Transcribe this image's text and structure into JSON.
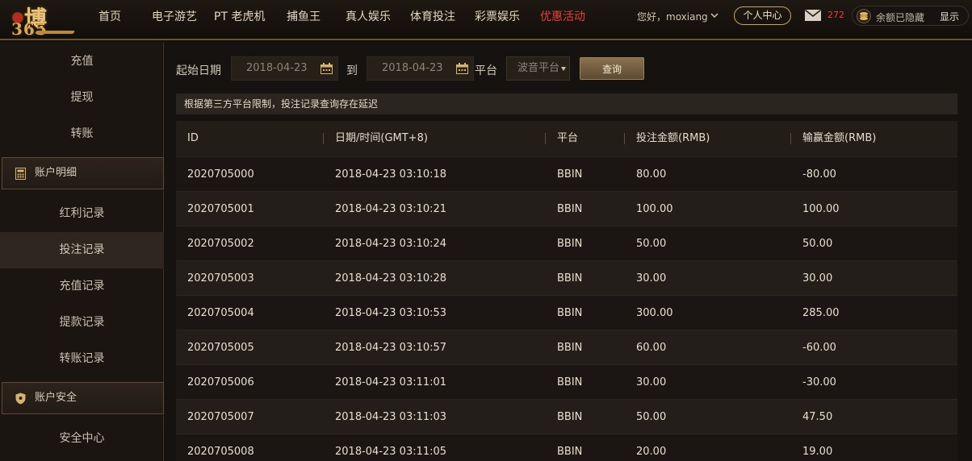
{
  "header": {
    "logo": {
      "text": "博",
      "number": "365"
    },
    "nav": [
      {
        "label": "首页",
        "active": false
      },
      {
        "label": "电子游艺",
        "active": false
      },
      {
        "label": "PT 老虎机",
        "active": false
      },
      {
        "label": "捕鱼王",
        "active": false
      },
      {
        "label": "真人娱乐",
        "active": false
      },
      {
        "label": "体育投注",
        "active": false
      },
      {
        "label": "彩票娱乐",
        "active": false
      },
      {
        "label": "优惠活动",
        "active": true
      }
    ],
    "greeting": "您好，moxiang",
    "personal_center": "个人中心",
    "mail_count": "272",
    "balance_hidden": "余额已隐藏",
    "show_label": "显示"
  },
  "sidebar": {
    "top_items": [
      {
        "label": "充值"
      },
      {
        "label": "提现"
      },
      {
        "label": "转账"
      }
    ],
    "section_account": {
      "label": "账户明细"
    },
    "account_items": [
      {
        "label": "红利记录",
        "selected": false
      },
      {
        "label": "投注记录",
        "selected": true
      },
      {
        "label": "充值记录",
        "selected": false
      },
      {
        "label": "提款记录",
        "selected": false
      },
      {
        "label": "转账记录",
        "selected": false
      }
    ],
    "section_security": {
      "label": "账户安全"
    },
    "security_items": [
      {
        "label": "安全中心"
      }
    ]
  },
  "filter": {
    "start_label": "起始日期",
    "start_value": "2018-04-23",
    "to_label": "到",
    "end_value": "2018-04-23",
    "platform_label": "平台",
    "platform_value": "波音平台",
    "query_label": "查询"
  },
  "notice": "根据第三方平台限制，投注记录查询存在延迟",
  "table": {
    "headers": [
      "ID",
      "日期/时间(GMT+8)",
      "平台",
      "投注金额(RMB)",
      "输赢金额(RMB)"
    ],
    "rows": [
      [
        "2020705000",
        "2018-04-23 03:10:18",
        "BBIN",
        "80.00",
        "-80.00"
      ],
      [
        "2020705001",
        "2018-04-23 03:10:21",
        "BBIN",
        "100.00",
        "100.00"
      ],
      [
        "2020705002",
        "2018-04-23 03:10:24",
        "BBIN",
        "50.00",
        "50.00"
      ],
      [
        "2020705003",
        "2018-04-23 03:10:28",
        "BBIN",
        "30.00",
        "30.00"
      ],
      [
        "2020705004",
        "2018-04-23 03:10:53",
        "BBIN",
        "300.00",
        "285.00"
      ],
      [
        "2020705005",
        "2018-04-23 03:10:57",
        "BBIN",
        "60.00",
        "-60.00"
      ],
      [
        "2020705006",
        "2018-04-23 03:11:01",
        "BBIN",
        "30.00",
        "-30.00"
      ],
      [
        "2020705007",
        "2018-04-23 03:11:03",
        "BBIN",
        "50.00",
        "47.50"
      ],
      [
        "2020705008",
        "2018-04-23 03:11:05",
        "BBIN",
        "20.00",
        "19.00"
      ]
    ]
  },
  "colors": {
    "accent_gold": "#c9a55c",
    "active_red": "#e8413a",
    "background": "#120f0c"
  },
  "icons": {
    "mail": "mail-icon",
    "coin": "coin-stack-icon",
    "calendar": "calendar-icon",
    "calculator": "calculator-icon",
    "shield": "shield-icon",
    "chevron": "chevron-down-icon"
  }
}
